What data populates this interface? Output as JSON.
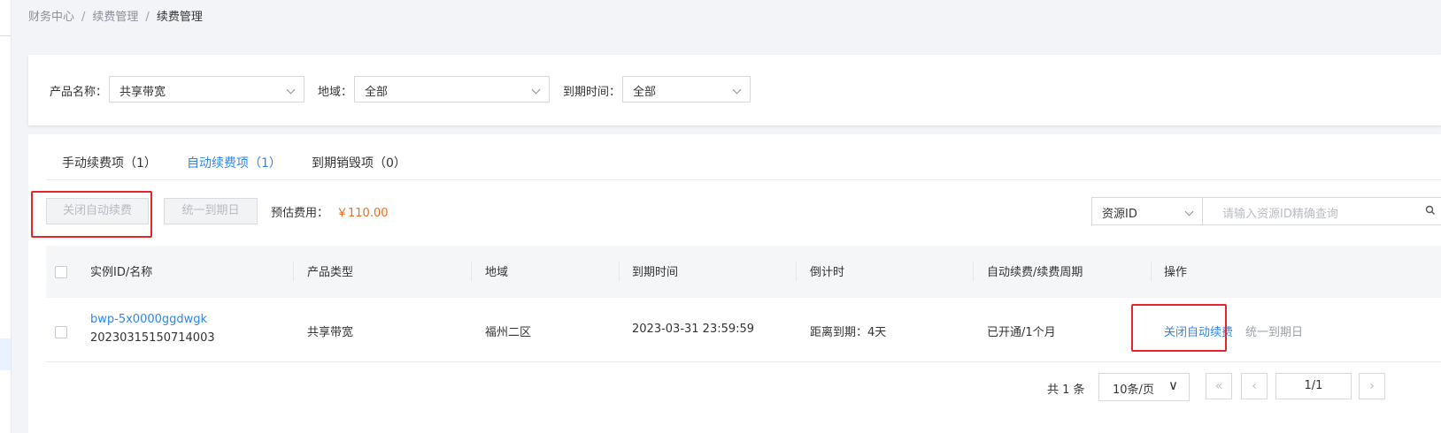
{
  "breadcrumb": {
    "items": [
      "财务中心",
      "续费管理",
      "续费管理"
    ],
    "separator": "/"
  },
  "filters": {
    "product_label": "产品名称：",
    "product_value": "共享带宽",
    "region_label": "地域：",
    "region_value": "全部",
    "expire_label": "到期时间：",
    "expire_value": "全部"
  },
  "tabs": [
    {
      "label": "手动续费项（1）",
      "active": false
    },
    {
      "label": "自动续费项（1）",
      "active": true
    },
    {
      "label": "到期销毁项（0）",
      "active": false
    }
  ],
  "toolbar": {
    "close_auto_renew": "关闭自动续费",
    "unify_expire_day": "统一到期日",
    "estimate_label": "预估费用：",
    "estimate_value": "￥110.00",
    "search_field_select": "资源ID",
    "search_placeholder": "请输入资源ID精确查询"
  },
  "table": {
    "headers": [
      "实例ID/名称",
      "产品类型",
      "地域",
      "到期时间",
      "倒计时",
      "自动续费/续费周期",
      "操作"
    ],
    "rows": [
      {
        "instance_id": "bwp-5x0000ggdwgk",
        "instance_name": "20230315150714003",
        "product_type": "共享带宽",
        "region": "福州二区",
        "expire_time": "2023-03-31 23:59:59",
        "countdown": "距离到期：4天",
        "auto_renew": "已开通/1个月",
        "actions": {
          "close_auto_renew": "关闭自动续费",
          "unify_expire_day": "统一到期日"
        }
      }
    ]
  },
  "pagination": {
    "total": "共 1 条",
    "page_size": "10条/页",
    "page_indicator": "1/1",
    "first_glyph": "«",
    "prev_glyph": "‹",
    "next_glyph": "›",
    "page_size_glyph": "∨"
  },
  "colors": {
    "accent": "#2f86ea",
    "highlight_box": "#e4262b",
    "price": "#f06a1f"
  },
  "icons": [
    "chevron-down-icon",
    "search-icon",
    "first-page-icon",
    "prev-page-icon",
    "next-page-icon"
  ]
}
